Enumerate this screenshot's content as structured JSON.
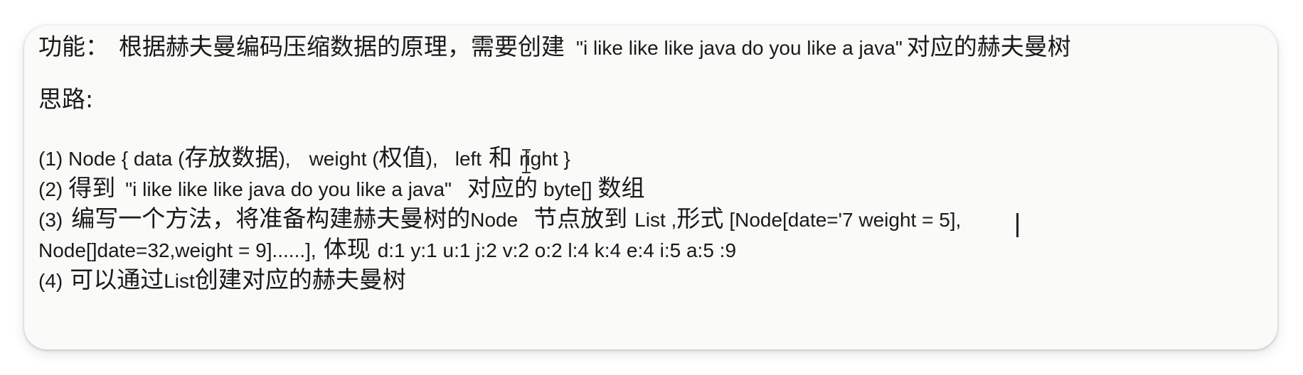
{
  "document": {
    "line1": {
      "label": "功能：",
      "text": "根据赫夫曼编码压缩数据的原理，需要创建",
      "quote": "\"i like like like java do you like a java\"",
      "tail": "对应的赫夫曼树"
    },
    "line2": "思路:",
    "step1": {
      "prefix": "(1) Node { data (",
      "cn1": "存放数据",
      "mid1": "),",
      "w": "weight (",
      "cn2": "权值",
      "mid2": "),",
      "left": "left",
      "cn3": "和",
      "right": "right }"
    },
    "step2": {
      "prefix": "(2)",
      "cn1": "得到",
      "quote": "\"i like like like java do you like a java\"",
      "cn2": "对应的",
      "code": "byte[]",
      "cn3": "数组"
    },
    "step3": {
      "prefix": "(3)",
      "cn1": "编写一个方法，将准备构建赫夫曼树的",
      "node": "Node",
      "cn2": "节点放到",
      "list": "List ,",
      "cn3": "形式",
      "code": "[Node[date='7 ",
      "code2": "weight = 5],"
    },
    "step3b": {
      "code": "Node[]date=32,weight  = 9]......],",
      "cn": "体现",
      "freq": "d:1  y:1  u:1  j:2   v:2   o:2   l:4   k:4   e:4  i:5   a:5    :9"
    },
    "step4": {
      "prefix": "(4)",
      "cn1": "可以通过",
      "list": "List",
      "cn2": "创建对应的赫夫曼树"
    }
  }
}
